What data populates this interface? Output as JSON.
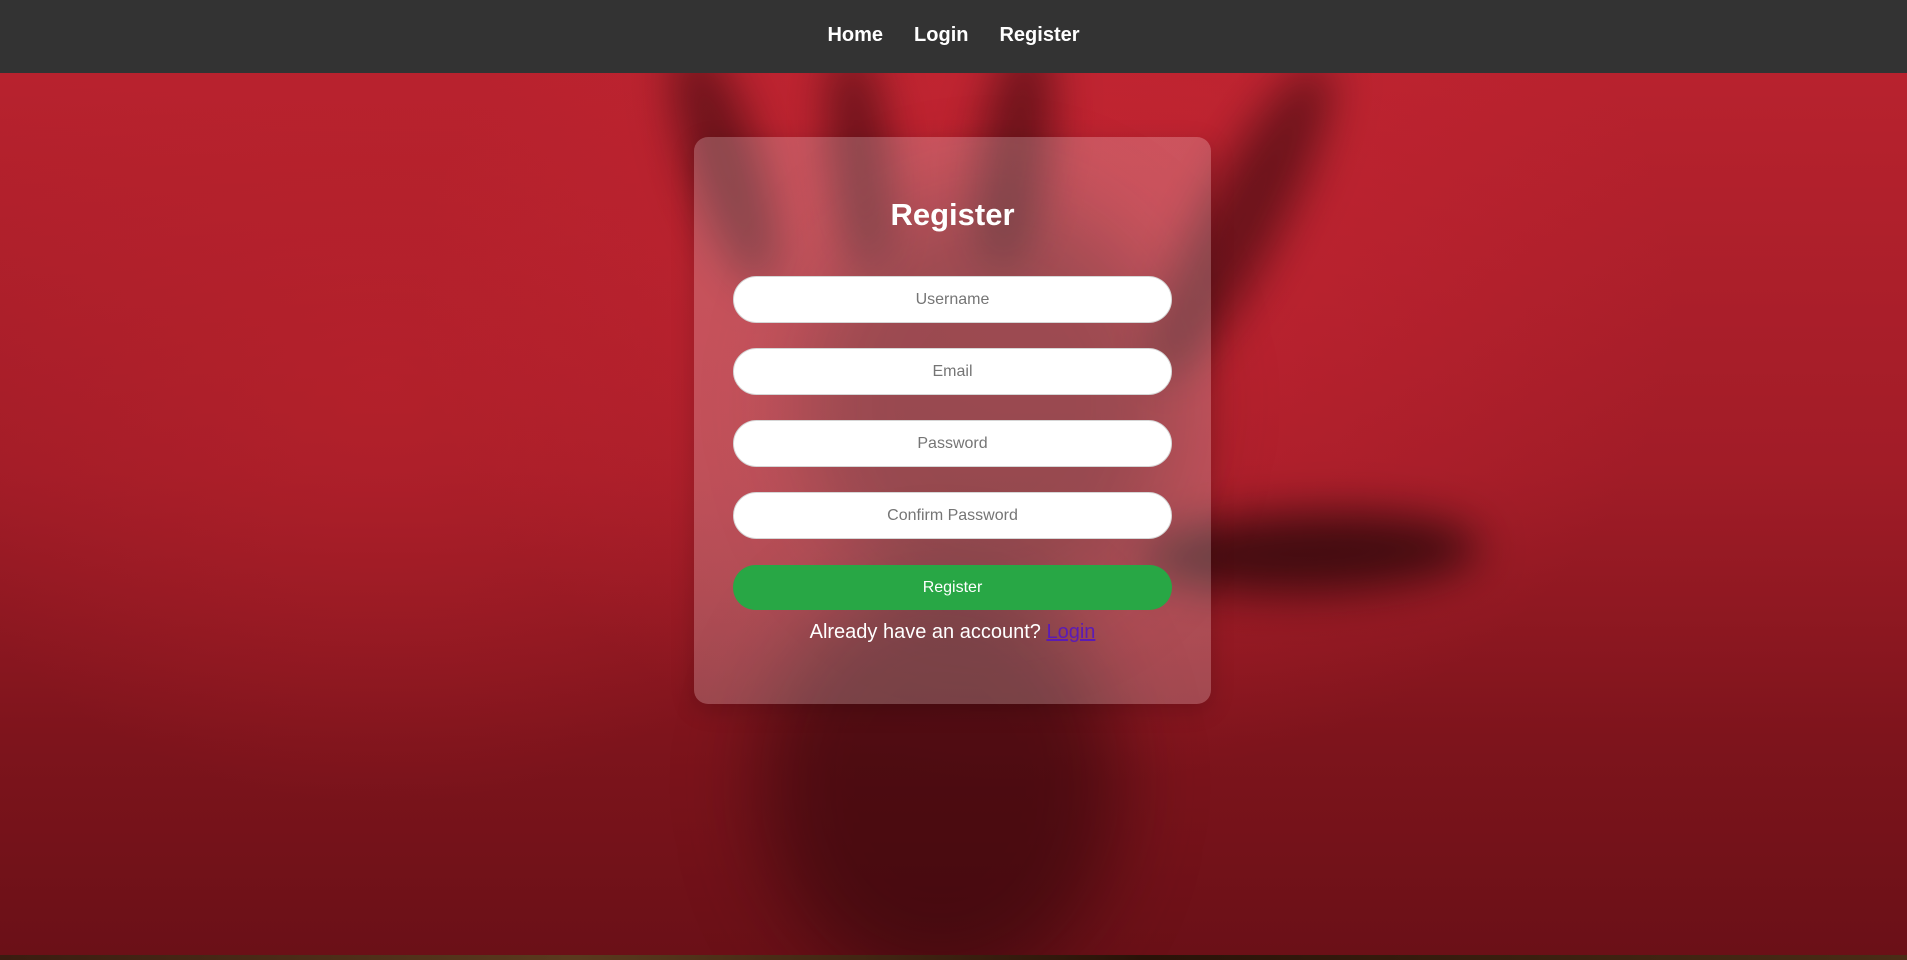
{
  "nav": {
    "home_label": "Home",
    "login_label": "Login",
    "register_label": "Register"
  },
  "form": {
    "title": "Register",
    "username_placeholder": "Username",
    "email_placeholder": "Email",
    "password_placeholder": "Password",
    "confirm_password_placeholder": "Confirm Password",
    "submit_label": "Register",
    "login_prompt_text": "Already have an account?",
    "login_link_label": "Login"
  },
  "colors": {
    "navbar_bg": "#333333",
    "submit_button_bg": "#28a745",
    "login_link": "#5b1bb5",
    "background_red": "#a11c27"
  }
}
